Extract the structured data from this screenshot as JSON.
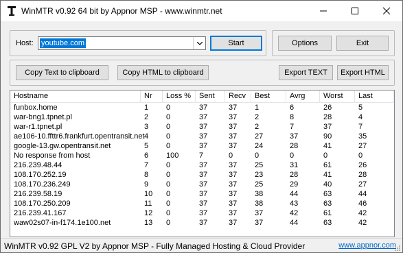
{
  "titlebar": {
    "title": "WinMTR v0.92 64 bit by Appnor MSP - www.winmtr.net",
    "icons": {
      "app": "winmtr-app-icon",
      "minimize": "minimize-icon",
      "maximize": "maximize-icon",
      "close": "close-icon"
    }
  },
  "host": {
    "label": "Host:",
    "value": "youtube.com"
  },
  "buttons": {
    "start": "Start",
    "options": "Options",
    "exit": "Exit",
    "copy_text": "Copy Text to clipboard",
    "copy_html": "Copy HTML to clipboard",
    "export_text": "Export TEXT",
    "export_html": "Export HTML"
  },
  "table": {
    "columns": [
      "Hostname",
      "Nr",
      "Loss %",
      "Sent",
      "Recv",
      "Best",
      "Avrg",
      "Worst",
      "Last"
    ],
    "rows": [
      [
        "funbox.home",
        "1",
        "0",
        "37",
        "37",
        "1",
        "6",
        "26",
        "5"
      ],
      [
        "war-bng1.tpnet.pl",
        "2",
        "0",
        "37",
        "37",
        "2",
        "8",
        "28",
        "4"
      ],
      [
        "war-r1.tpnet.pl",
        "3",
        "0",
        "37",
        "37",
        "2",
        "7",
        "37",
        "7"
      ],
      [
        "ae106-10.ffttr6.frankfurt.opentransit.net",
        "4",
        "0",
        "37",
        "37",
        "27",
        "37",
        "90",
        "35"
      ],
      [
        "google-13.gw.opentransit.net",
        "5",
        "0",
        "37",
        "37",
        "24",
        "28",
        "41",
        "27"
      ],
      [
        "No response from host",
        "6",
        "100",
        "7",
        "0",
        "0",
        "0",
        "0",
        "0"
      ],
      [
        "216.239.48.44",
        "7",
        "0",
        "37",
        "37",
        "25",
        "31",
        "61",
        "26"
      ],
      [
        "108.170.252.19",
        "8",
        "0",
        "37",
        "37",
        "23",
        "28",
        "41",
        "28"
      ],
      [
        "108.170.236.249",
        "9",
        "0",
        "37",
        "37",
        "25",
        "29",
        "40",
        "27"
      ],
      [
        "216.239.58.19",
        "10",
        "0",
        "37",
        "37",
        "38",
        "44",
        "63",
        "44"
      ],
      [
        "108.170.250.209",
        "11",
        "0",
        "37",
        "37",
        "38",
        "43",
        "63",
        "46"
      ],
      [
        "216.239.41.167",
        "12",
        "0",
        "37",
        "37",
        "37",
        "42",
        "61",
        "42"
      ],
      [
        "waw02s07-in-f174.1e100.net",
        "13",
        "0",
        "37",
        "37",
        "37",
        "44",
        "63",
        "42"
      ]
    ]
  },
  "status": {
    "text": "WinMTR v0.92 GPL V2 by Appnor MSP - Fully Managed Hosting & Cloud Provider",
    "link": "www.appnor.com"
  },
  "colors": {
    "accent": "#0078d7",
    "link": "#0066cc"
  }
}
